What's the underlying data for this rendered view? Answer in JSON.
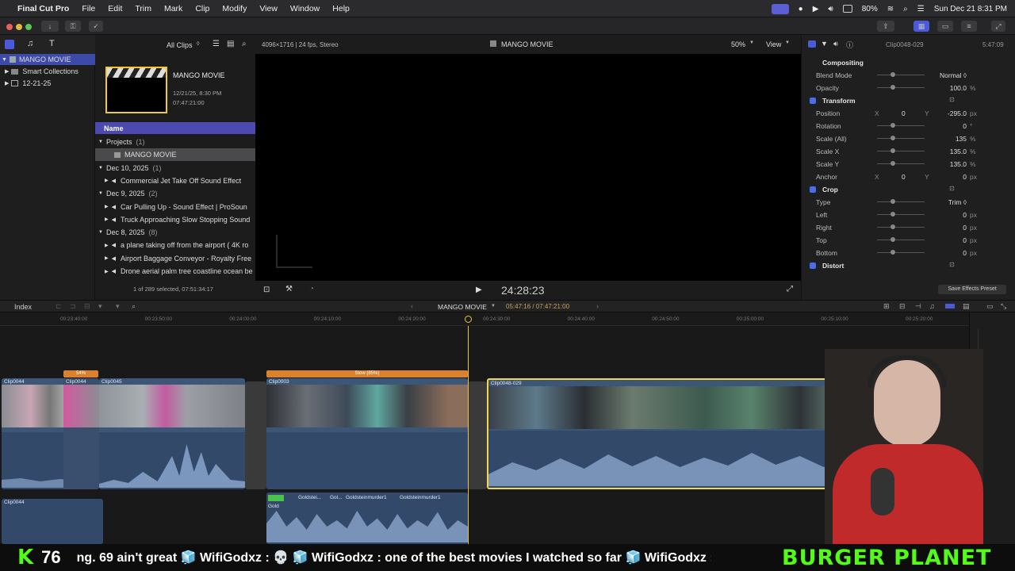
{
  "menubar": {
    "app": "Final Cut Pro",
    "items": [
      "File",
      "Edit",
      "Trim",
      "Mark",
      "Clip",
      "Modify",
      "View",
      "Window",
      "Help"
    ],
    "battery": "80%",
    "datetime": "Sun Dec 21  8:31 PM"
  },
  "sidebar": {
    "items": [
      "MANGO MOVIE",
      "Smart Collections",
      "12-21-25"
    ]
  },
  "browser": {
    "filter": "All Clips",
    "project_thumb": {
      "title": "MANGO MOVIE",
      "date": "12/21/25, 8:30 PM",
      "duration": "07:47:21:00"
    },
    "column": "Name",
    "rows": [
      {
        "kind": "group",
        "text": "Projects",
        "count": "(1)"
      },
      {
        "kind": "item",
        "text": "MANGO MOVIE"
      },
      {
        "kind": "group",
        "text": "Dec 10, 2025",
        "count": "(1)"
      },
      {
        "kind": "clip",
        "text": "Commercial Jet Take Off Sound Effect"
      },
      {
        "kind": "group",
        "text": "Dec 9, 2025",
        "count": "(2)"
      },
      {
        "kind": "clip",
        "text": "Car Pulling Up - Sound Effect  |  ProSoun"
      },
      {
        "kind": "clip",
        "text": "Truck Approaching Slow Stopping Sound"
      },
      {
        "kind": "group",
        "text": "Dec 8, 2025",
        "count": "(8)"
      },
      {
        "kind": "clip",
        "text": "a plane taking off from the airport ( 4K ro"
      },
      {
        "kind": "clip",
        "text": "Airport Baggage Conveyor - Royalty Free"
      },
      {
        "kind": "clip",
        "text": "Drone aerial palm tree coastline ocean be"
      }
    ],
    "status": "1 of 289 selected, 07:51:34:17"
  },
  "viewer": {
    "format": "4096×1716 | 24 fps, Stereo",
    "title": "MANGO MOVIE",
    "zoom": "50%",
    "view": "View",
    "timecode": "24:28:23"
  },
  "inspector": {
    "clip": "Clip0048-029",
    "duration": "5:47:09",
    "rows": [
      {
        "label": "Compositing",
        "section": true
      },
      {
        "label": "Blend Mode",
        "val": "Normal ◊"
      },
      {
        "label": "Opacity",
        "val": "100.0",
        "unit": "%"
      },
      {
        "label": "Transform",
        "section": true,
        "check": true
      },
      {
        "label": "Position",
        "x": "0",
        "y": "-295.0",
        "unit": "px"
      },
      {
        "label": "Rotation",
        "val": "0",
        "unit": "°"
      },
      {
        "label": "Scale (All)",
        "val": "135",
        "unit": "%"
      },
      {
        "label": "Scale X",
        "val": "135.0",
        "unit": "%"
      },
      {
        "label": "Scale Y",
        "val": "135.0",
        "unit": "%"
      },
      {
        "label": "Anchor",
        "x": "0",
        "y": "0",
        "unit": "px"
      },
      {
        "label": "Crop",
        "section": true,
        "check": true
      },
      {
        "label": "Type",
        "val": "Trim ◊"
      },
      {
        "label": "Left",
        "val": "0",
        "unit": "px"
      },
      {
        "label": "Right",
        "val": "0",
        "unit": "px"
      },
      {
        "label": "Top",
        "val": "0",
        "unit": "px"
      },
      {
        "label": "Bottom",
        "val": "0",
        "unit": "px"
      },
      {
        "label": "Distort",
        "section": true,
        "check": true
      }
    ],
    "save_preset": "Save Effects Preset"
  },
  "timeline": {
    "index": "Index",
    "project": "MANGO MOVIE",
    "position": "05:47:16 / 07:47:21:00",
    "ticks": [
      "00:23:40:00",
      "00:23:50:00",
      "00:24:00:00",
      "00:24:10:00",
      "00:24:20:00",
      "00:24:30:00",
      "00:24:40:00",
      "00:24:50:00",
      "00:25:00:00",
      "00:25:10:00",
      "00:25:20:00"
    ],
    "clips": [
      "Clip0044",
      "Clip0044",
      "Clip0045",
      "Clip0003",
      "Clip0048-029"
    ],
    "speed_labels": [
      "54%",
      "Slow (85%)"
    ],
    "audio_clips": [
      "Clip0044",
      "Gold",
      "Goldstei...",
      "Gol...",
      "Goldsteinmurder1",
      "Goldsteinmurder1"
    ]
  },
  "ticker": {
    "count": "76",
    "text": "ng. 69 ain't great  🧊 WifiGodxz : 💀  🧊 WifiGodxz : one of the best movies I watched so far  🧊 WifiGodxz : 💀",
    "brand": "BURGER PLANET"
  },
  "colors": {
    "accent": "#5a5fd6",
    "selection": "#f0d84a",
    "clip": "#3c5678",
    "speed": "#d9822b"
  }
}
